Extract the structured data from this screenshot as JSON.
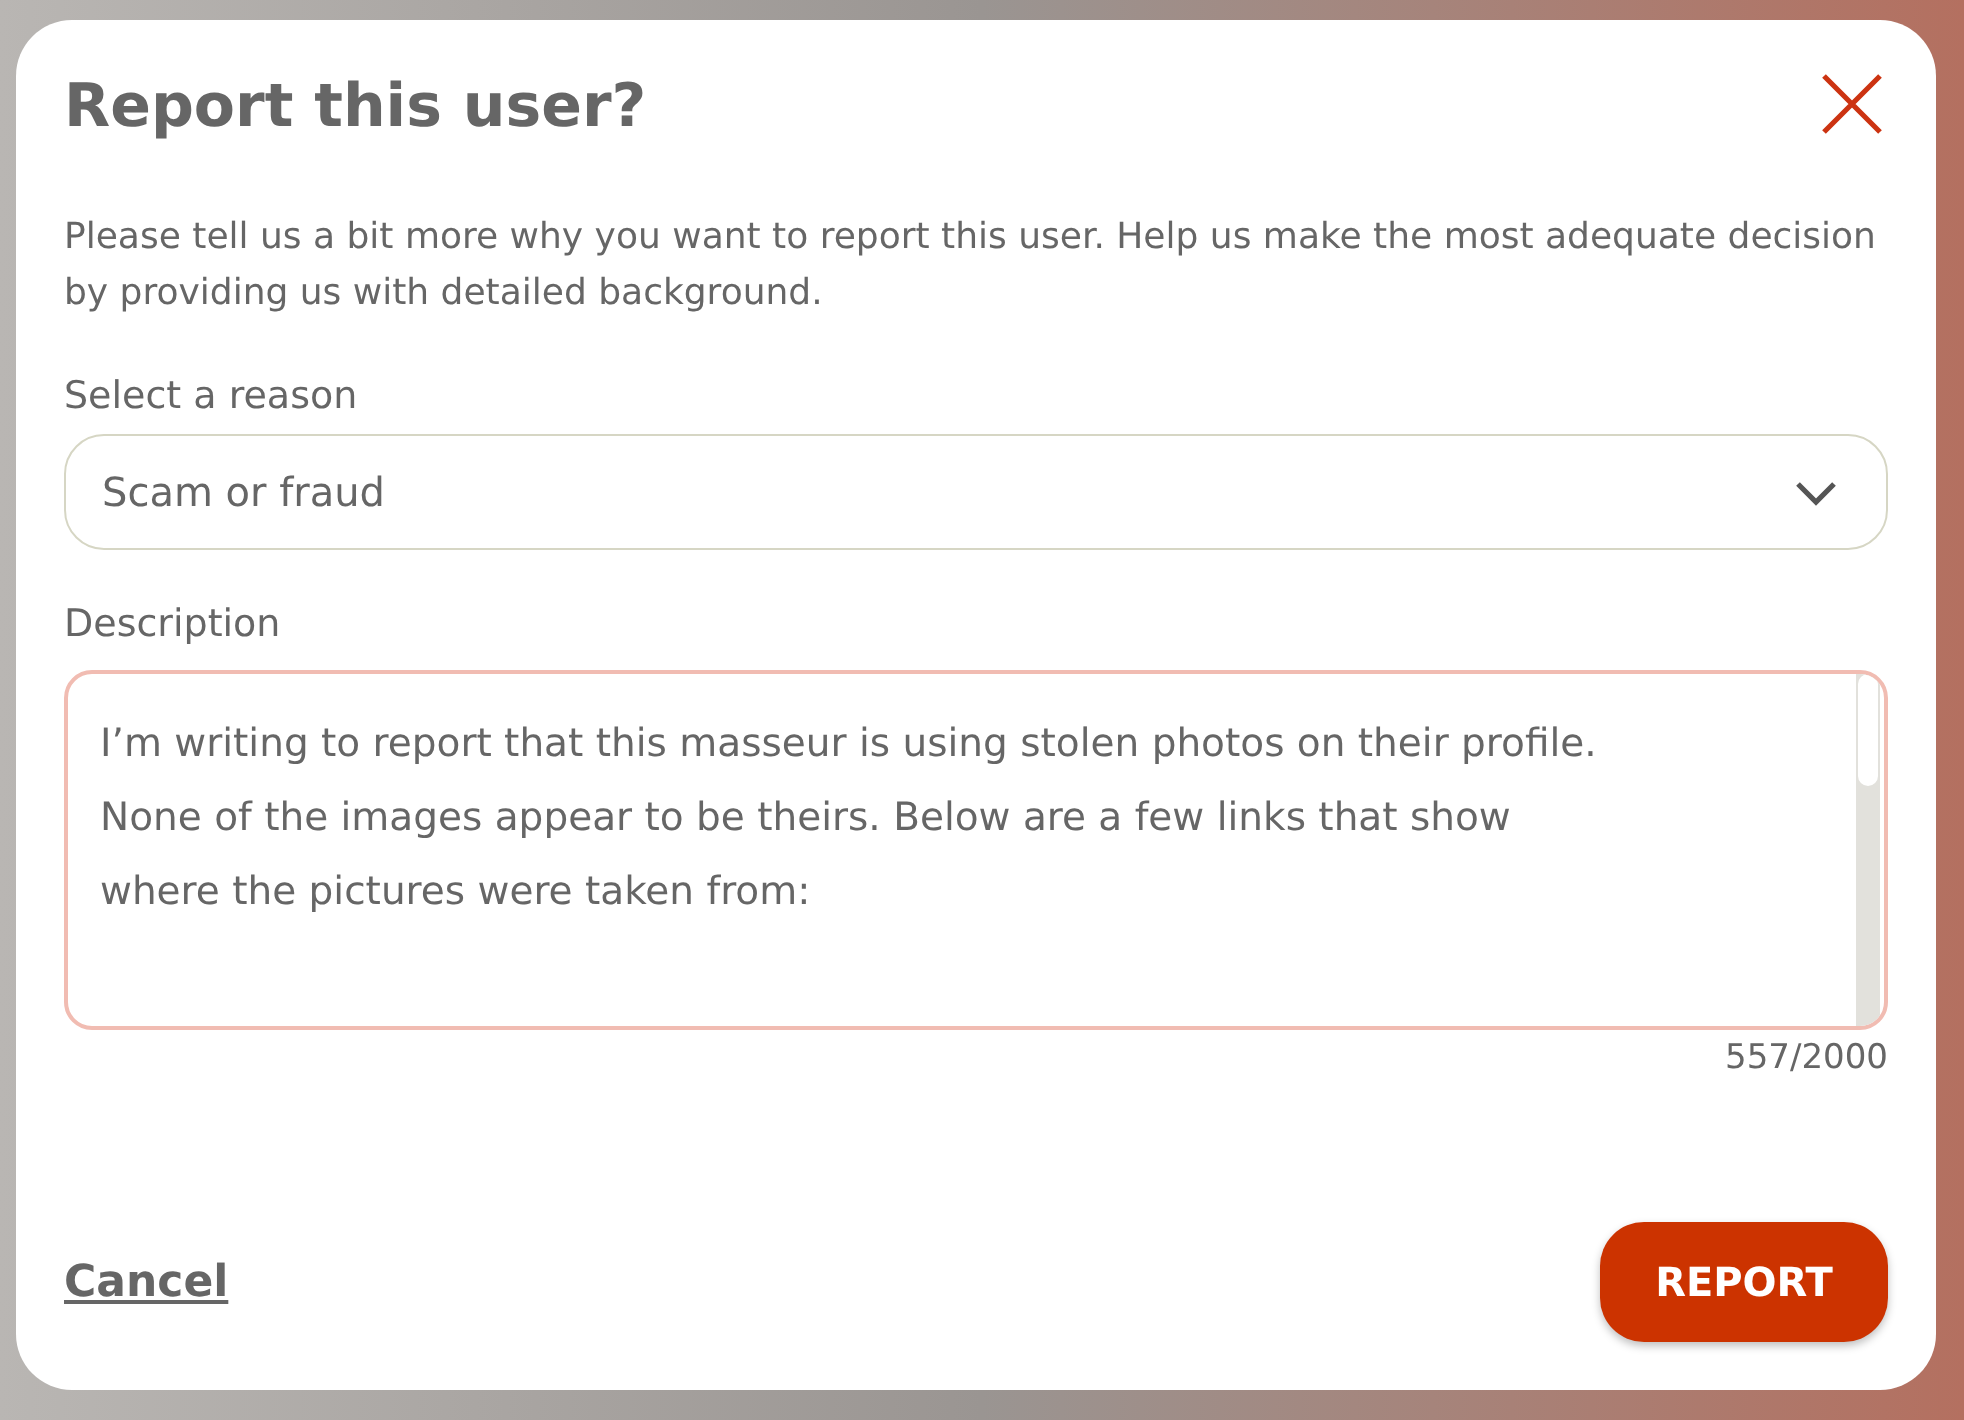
{
  "dialog": {
    "title": "Report this user?",
    "intro": "Please tell us a bit more why you want to report this user. Help us make the most adequate decision by providing us with detailed background.",
    "reason": {
      "label": "Select a reason",
      "value": "Scam or fraud"
    },
    "description": {
      "label": "Description",
      "value_lines": [
        "I’m writing to report that this masseur is using stolen photos on their profile.",
        "None of the images appear to be theirs. Below are a few links that show",
        "where the pictures were taken from:"
      ],
      "counter": "557/2000"
    },
    "buttons": [
      {
        "kind": "link",
        "label": "Cancel"
      },
      {
        "kind": "primary",
        "label": "REPORT"
      }
    ]
  }
}
